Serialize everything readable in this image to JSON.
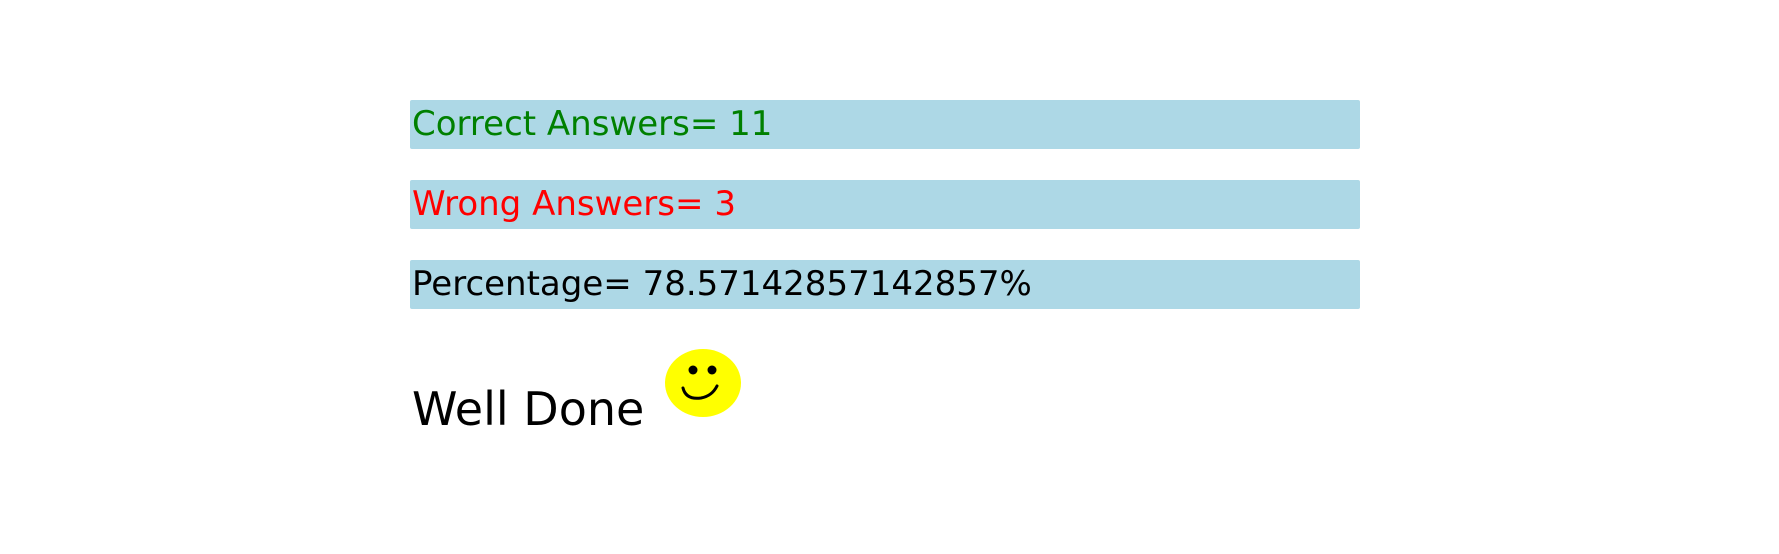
{
  "results": {
    "correct": {
      "label": "Correct Answers=",
      "value": "11",
      "color": "#008000"
    },
    "wrong": {
      "label": "Wrong Answers=",
      "value": "3",
      "color": "#ff0000"
    },
    "percentage": {
      "label": "Percentage=",
      "value": "78.57142857142857%",
      "color": "#000000"
    }
  },
  "message": {
    "text": "Well Done",
    "icon": "smiley-face-icon"
  },
  "colors": {
    "bar_background": "#add8e6",
    "smiley_fill": "#ffff00"
  }
}
